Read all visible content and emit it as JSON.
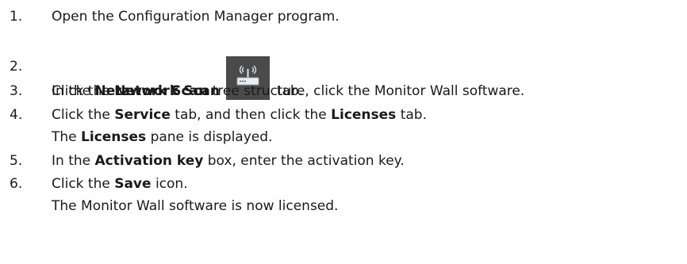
{
  "steps": [
    {
      "number": "1.",
      "parts": [
        "Open the Configuration Manager program."
      ]
    },
    {
      "number": "2.",
      "parts": [
        "Click the ",
        "Network Scan",
        " tab."
      ]
    },
    {
      "number": "3.",
      "parts": [
        "In the ",
        "Netzwork Scan",
        " tree structure, click the Monitor Wall software."
      ]
    },
    {
      "number": "4.",
      "parts": [
        "Click the ",
        "Service",
        " tab, and then click the ",
        "Licenses",
        " tab."
      ]
    },
    {
      "number": "5.",
      "parts": [
        "In the ",
        "Activation key",
        " box, enter the activation key."
      ]
    },
    {
      "number": "6.",
      "parts": [
        "Click the ",
        "Save",
        " icon."
      ]
    }
  ],
  "notes": {
    "step4": [
      "The ",
      "Licenses",
      " pane is displayed."
    ],
    "step6": [
      "The Monitor Wall software is now licensed."
    ]
  },
  "icons": {
    "network_scan": "network-scan-icon"
  }
}
